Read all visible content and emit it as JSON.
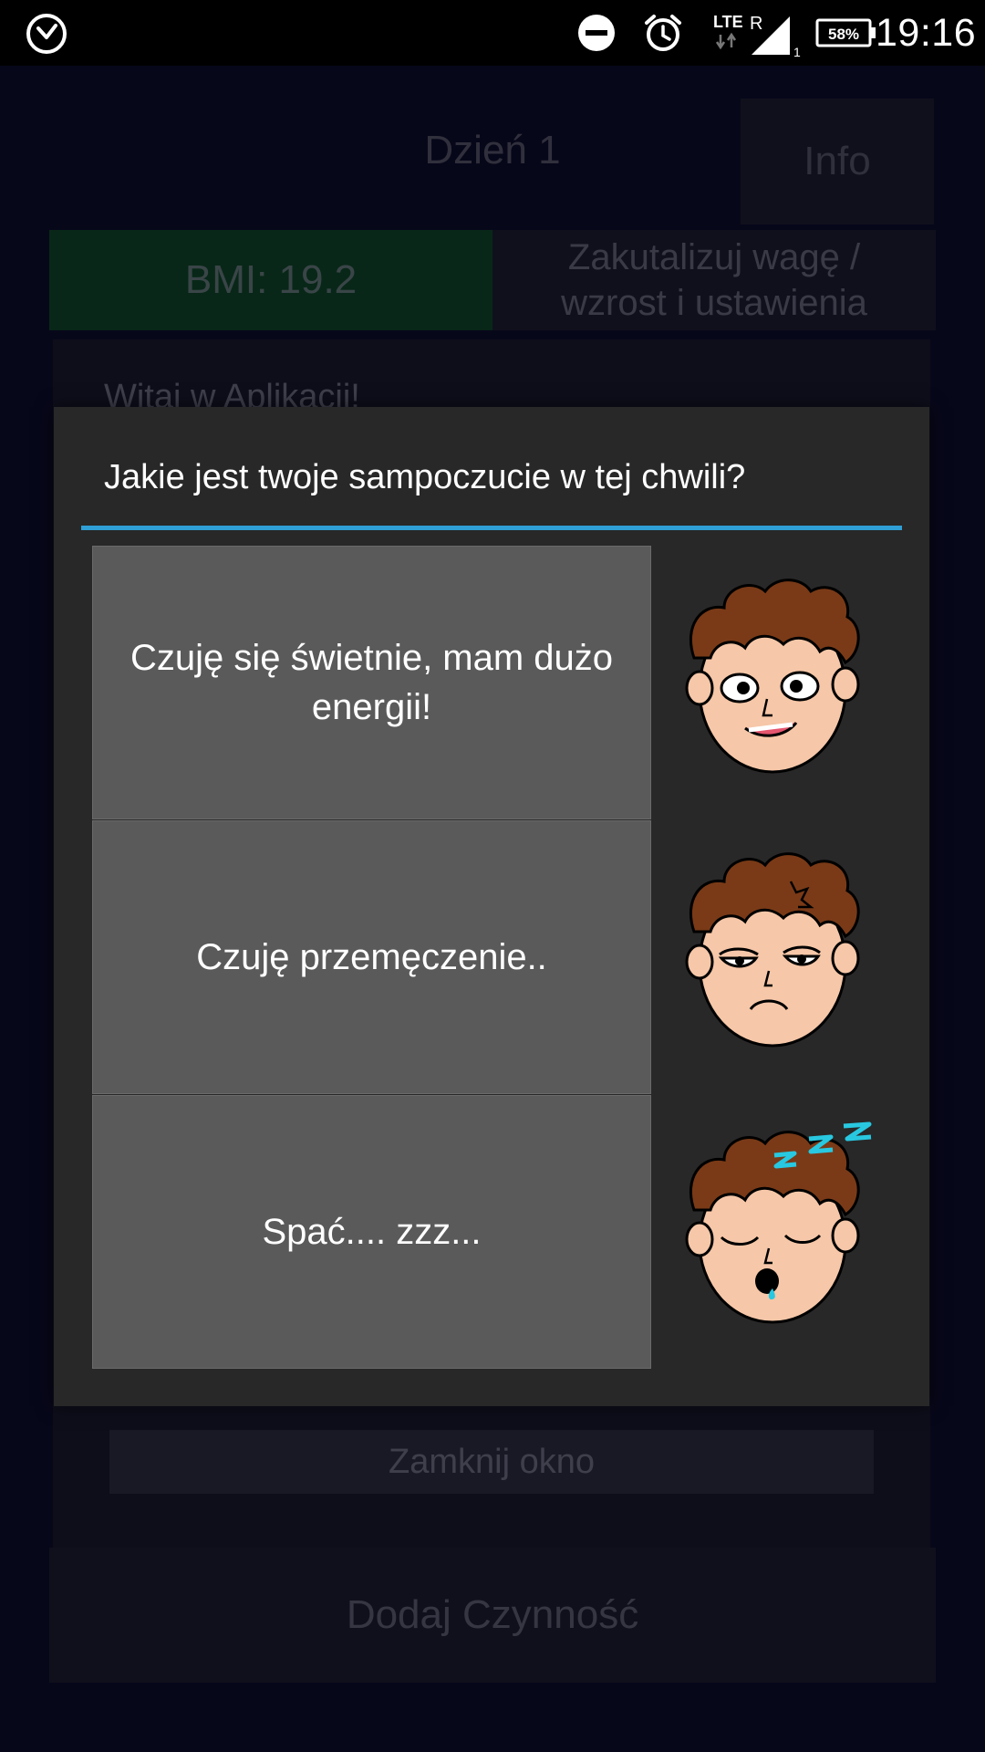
{
  "status_bar": {
    "time": "19:16",
    "battery": "58%",
    "network": "LTE",
    "network_roaming": "R",
    "signal_sub": "1",
    "icons": [
      "app-clock-icon",
      "do-not-disturb-icon",
      "alarm-icon",
      "lte-signal-icon",
      "battery-icon"
    ]
  },
  "background_app": {
    "tab_day": "Dzień 1",
    "tab_info": "Info",
    "bmi": "BMI: 19.2",
    "update_button": "Zakutalizuj wagę / wzrost i ustawienia",
    "welcome": "Witaj w Aplikacji!",
    "close_button": "Zamknij okno",
    "add_activity": "Dodaj Czynność"
  },
  "dialog": {
    "title": "Jakie jest twoje sampoczucie w tej chwili?",
    "options": [
      {
        "label": "Czuję się świetnie, mam dużo energii!",
        "icon": "happy-face-icon"
      },
      {
        "label": "Czuję przemęczenie..",
        "icon": "tired-face-icon"
      },
      {
        "label": "Spać.... zzz...",
        "icon": "sleepy-face-icon"
      }
    ]
  },
  "colors": {
    "accent": "#2f9fd6",
    "dialog_bg": "#282828",
    "option_bg": "#5a5a5a",
    "bmi_green": "#0c7a16"
  }
}
